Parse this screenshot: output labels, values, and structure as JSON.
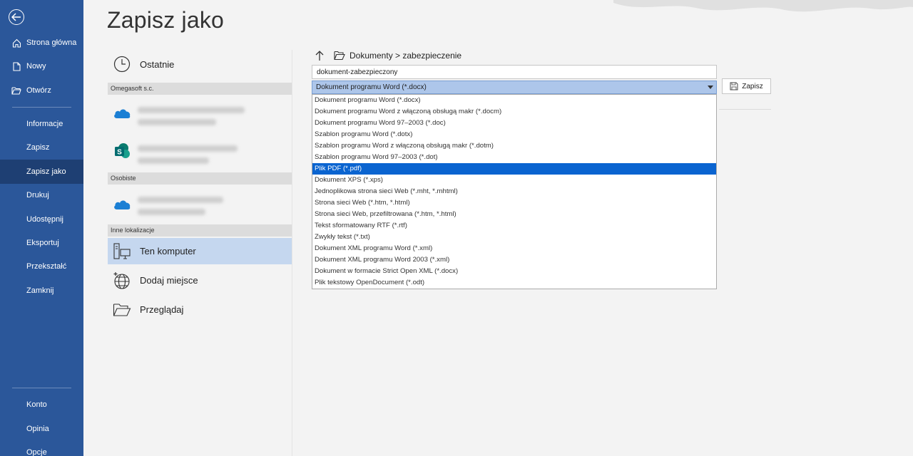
{
  "window": {
    "title": "Zapisz jako"
  },
  "nav": {
    "top": [
      {
        "label": "Strona główna",
        "icon": "home-icon"
      },
      {
        "label": "Nowy",
        "icon": "new-document-icon"
      },
      {
        "label": "Otwórz",
        "icon": "open-folder-icon"
      }
    ],
    "middle": [
      {
        "label": "Informacje"
      },
      {
        "label": "Zapisz"
      },
      {
        "label": "Zapisz jako",
        "active": true
      },
      {
        "label": "Drukuj"
      },
      {
        "label": "Udostępnij"
      },
      {
        "label": "Eksportuj"
      },
      {
        "label": "Przekształć"
      },
      {
        "label": "Zamknij"
      }
    ],
    "bottom": [
      {
        "label": "Konto"
      },
      {
        "label": "Opinia"
      },
      {
        "label": "Opcje"
      }
    ]
  },
  "locations": {
    "recent": "Ostatnie",
    "group_company": "Omegasoft  s.c.",
    "group_personal": "Osobiste",
    "group_other": "Inne lokalizacje",
    "this_pc": "Ten komputer",
    "add_place": "Dodaj miejsce",
    "browse": "Przeglądaj"
  },
  "save_pane": {
    "path": "Dokumenty > zabezpieczenie",
    "filename": "dokument-zabezpieczony",
    "selected_type": "Dokument programu Word (*.docx)",
    "save_label": "Zapisz",
    "types": [
      "Dokument programu Word (*.docx)",
      "Dokument programu Word z włączoną obsługą makr (*.docm)",
      "Dokument programu Word 97–2003 (*.doc)",
      "Szablon programu Word (*.dotx)",
      "Szablon programu Word z włączoną obsługą makr (*.dotm)",
      "Szablon programu Word 97–2003 (*.dot)",
      "Plik PDF (*.pdf)",
      "Dokument XPS (*.xps)",
      "Jednoplikowa strona sieci Web (*.mht, *.mhtml)",
      "Strona sieci Web (*.htm, *.html)",
      "Strona sieci Web, przefiltrowana (*.htm, *.html)",
      "Tekst sformatowany RTF (*.rtf)",
      "Zwykły tekst (*.txt)",
      "Dokument XML programu Word (*.xml)",
      "Dokument XML programu Word 2003 (*.xml)",
      "Dokument w formacie Strict Open XML (*.docx)",
      "Plik tekstowy OpenDocument (*.odt)"
    ],
    "highlighted_type": "Plik PDF (*.pdf)"
  },
  "colors": {
    "nav_bg": "#2b579a",
    "nav_active": "#1e3f73",
    "highlight": "#0a64d0",
    "selected_location": "#c5d7ef"
  }
}
